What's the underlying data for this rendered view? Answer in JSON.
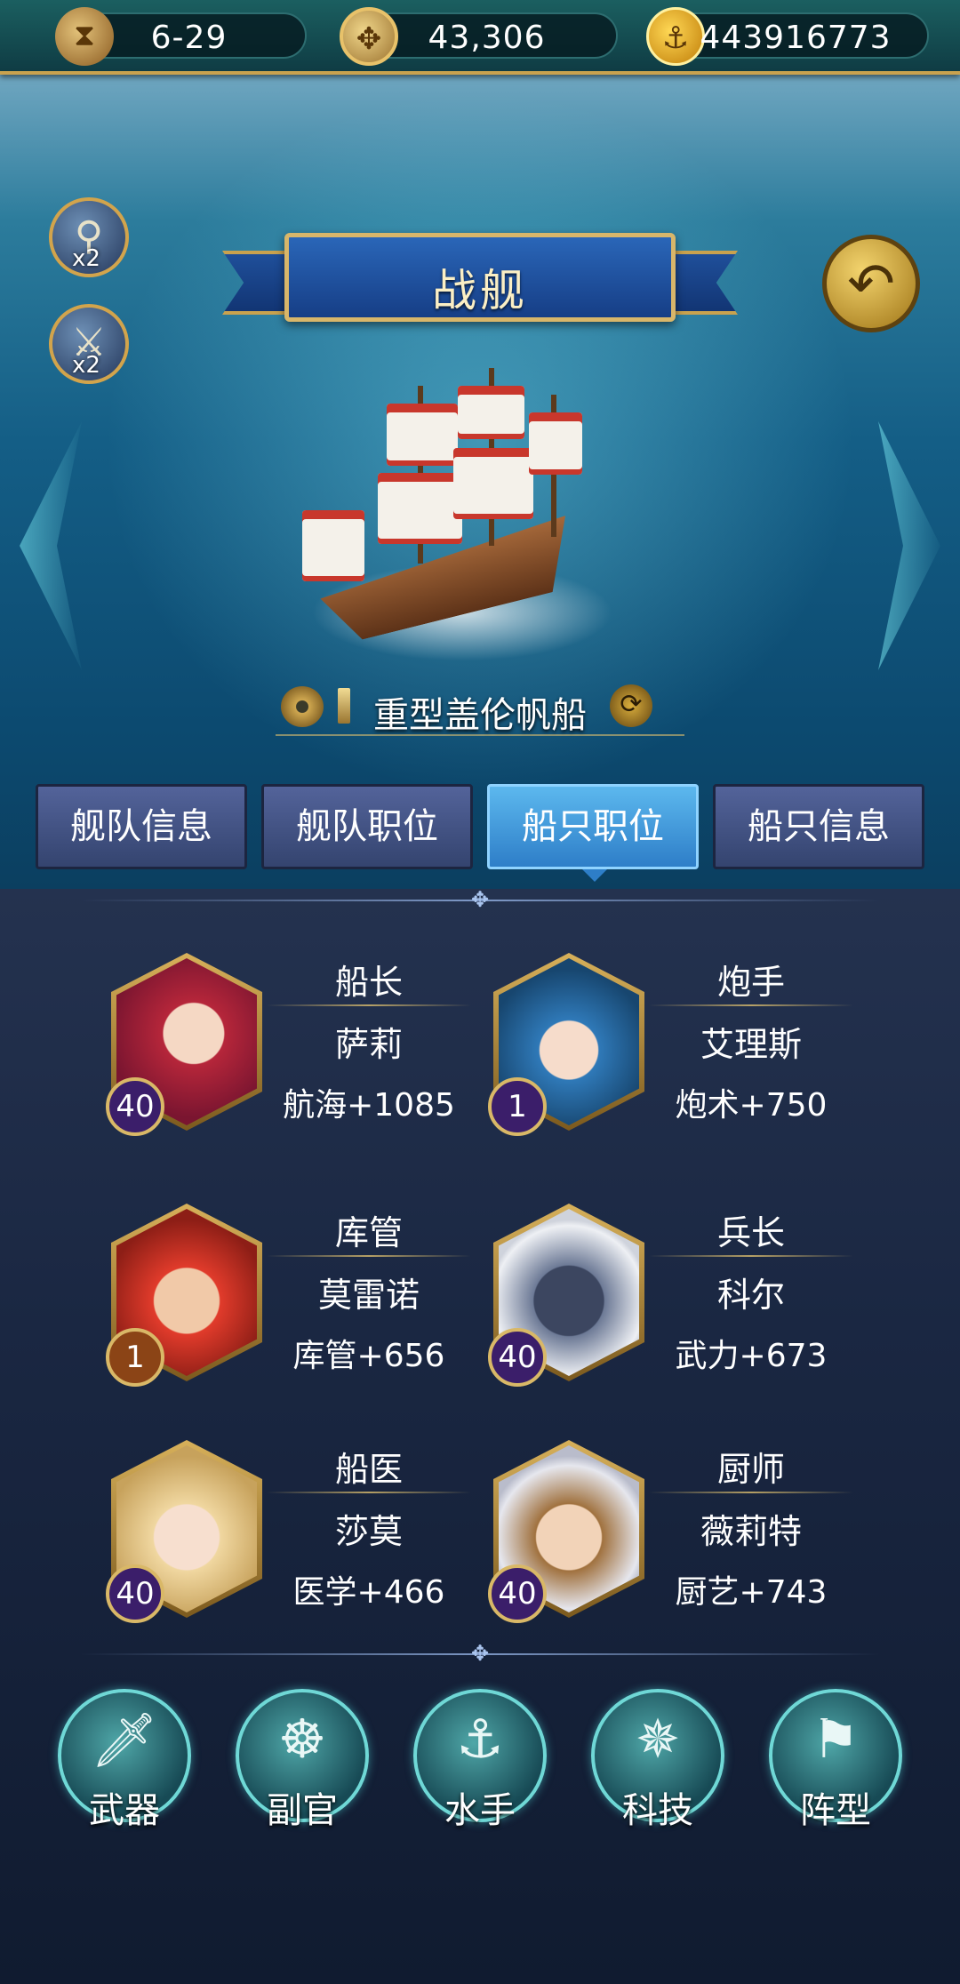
{
  "resources": {
    "time": "6-29",
    "compass_value": "43,306",
    "gold": "443916773"
  },
  "side_buttons": {
    "search_multiplier": "x2",
    "battle_multiplier": "x2"
  },
  "banner_title": "战舰",
  "ship": {
    "name": "重型盖伦帆船"
  },
  "tabs": [
    {
      "label": "舰队信息"
    },
    {
      "label": "舰队职位"
    },
    {
      "label": "船只职位"
    },
    {
      "label": "船只信息"
    }
  ],
  "active_tab": "船只职位",
  "crew": [
    {
      "role": "船长",
      "name": "萨莉",
      "stat": "航海+1085",
      "level": "40"
    },
    {
      "role": "炮手",
      "name": "艾理斯",
      "stat": "炮术+750",
      "level": "1"
    },
    {
      "role": "库管",
      "name": "莫雷诺",
      "stat": "库管+656",
      "level": "1"
    },
    {
      "role": "兵长",
      "name": "科尔",
      "stat": "武力+673",
      "level": "40"
    },
    {
      "role": "船医",
      "name": "莎莫",
      "stat": "医学+466",
      "level": "40"
    },
    {
      "role": "厨师",
      "name": "薇莉特",
      "stat": "厨艺+743",
      "level": "40"
    }
  ],
  "actions": [
    {
      "label": "武器",
      "icon": "sword-icon"
    },
    {
      "label": "副官",
      "icon": "helm-wheel-icon"
    },
    {
      "label": "水手",
      "icon": "hook-icon"
    },
    {
      "label": "科技",
      "icon": "compass-icon"
    },
    {
      "label": "阵型",
      "icon": "flag-icon"
    }
  ]
}
